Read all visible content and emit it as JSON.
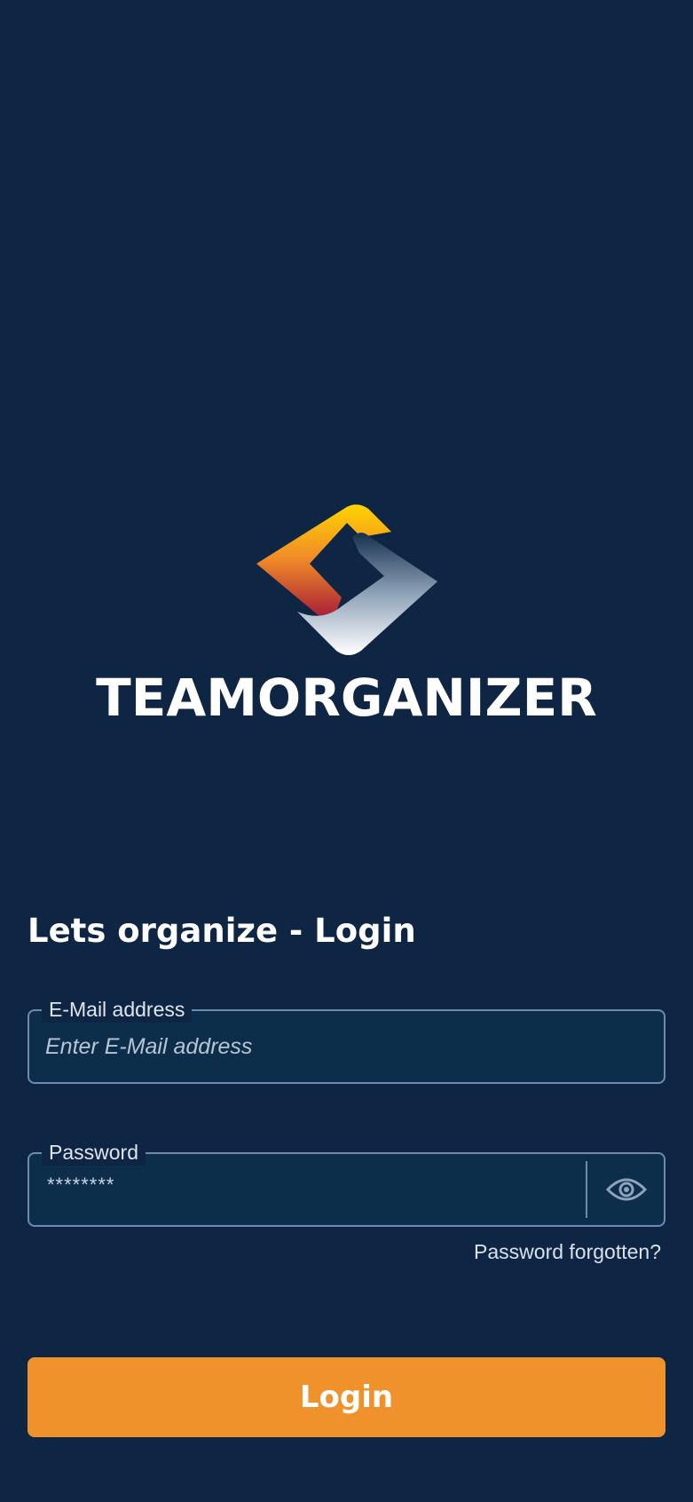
{
  "brand": {
    "name": "TEAMORGANIZER",
    "logo_icon": "teamorganizer-logo-icon"
  },
  "login": {
    "heading": "Lets organize - Login",
    "email": {
      "label": "E-Mail address",
      "placeholder": "Enter E-Mail address",
      "value": ""
    },
    "password": {
      "label": "Password",
      "masked_value": "********",
      "toggle_icon": "eye-icon"
    },
    "forgot_link": "Password forgotten?",
    "submit_label": "Login"
  },
  "colors": {
    "background": "#0e2543",
    "field_background": "#0d2e4b",
    "field_border": "#6b8bb0",
    "accent": "#f0922c"
  }
}
